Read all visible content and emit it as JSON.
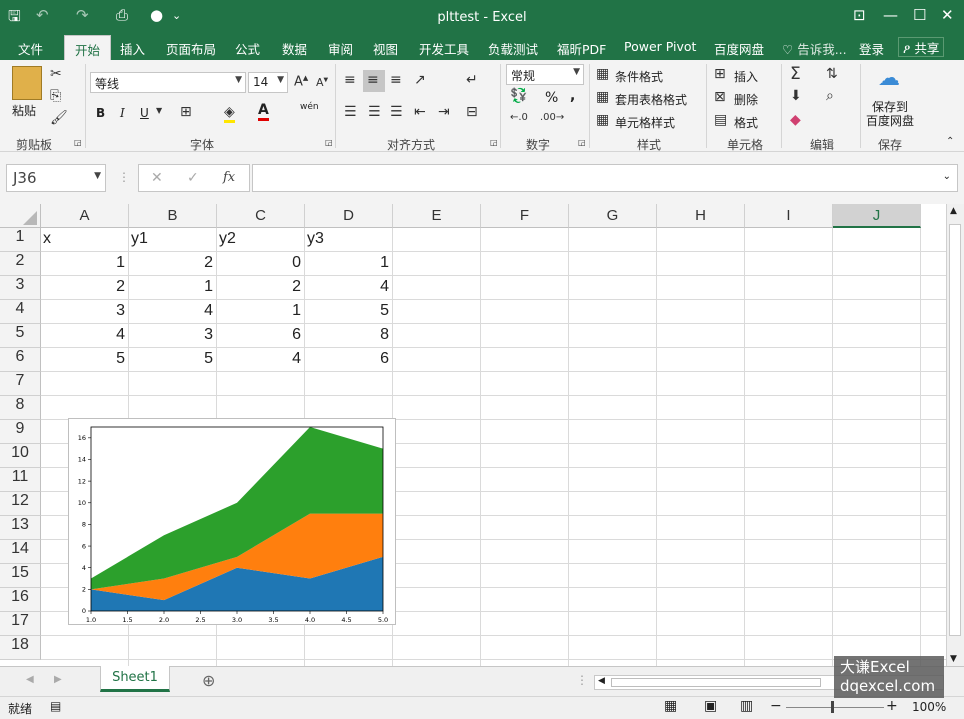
{
  "window": {
    "title": "plttest - Excel"
  },
  "tabs": [
    "文件",
    "开始",
    "插入",
    "页面布局",
    "公式",
    "数据",
    "审阅",
    "视图",
    "开发工具",
    "负载测试",
    "福昕PDF",
    "Power Pivot",
    "百度网盘"
  ],
  "active_tab": "开始",
  "tell_me": "告诉我...",
  "login": "登录",
  "share": "共享",
  "ribbon": {
    "clipboard": {
      "paste": "粘贴",
      "label": "剪贴板"
    },
    "font": {
      "name": "等线",
      "size": "14",
      "bold": "B",
      "italic": "I",
      "underline": "U",
      "phonetic": "wén",
      "label": "字体"
    },
    "alignment": {
      "label": "对齐方式"
    },
    "number": {
      "format": "常规",
      "percent": "%",
      "comma": ",",
      "label": "数字"
    },
    "styles": {
      "conditional": "条件格式",
      "table": "套用表格格式",
      "cell": "单元格样式",
      "label": "样式"
    },
    "cells": {
      "insert": "插入",
      "delete": "删除",
      "format": "格式",
      "label": "单元格"
    },
    "editing": {
      "label": "编辑"
    },
    "save": {
      "button": "保存到\n百度网盘",
      "label": "保存"
    }
  },
  "namebox": "J36",
  "fx": "fx",
  "columns": [
    "A",
    "B",
    "C",
    "D",
    "E",
    "F",
    "G",
    "H",
    "I",
    "J"
  ],
  "rows": [
    "1",
    "2",
    "3",
    "4",
    "5",
    "6",
    "7",
    "8",
    "9",
    "10",
    "11",
    "12",
    "13",
    "14",
    "15",
    "16",
    "17",
    "18"
  ],
  "headers": [
    "x",
    "y1",
    "y2",
    "y3"
  ],
  "table": [
    [
      1,
      2,
      0,
      1
    ],
    [
      2,
      1,
      2,
      4
    ],
    [
      3,
      4,
      1,
      5
    ],
    [
      4,
      3,
      6,
      8
    ],
    [
      5,
      5,
      4,
      6
    ]
  ],
  "sheet_tab": "Sheet1",
  "status": "就绪",
  "zoom": "100%",
  "watermark": {
    "line1": "大谦Excel",
    "line2": "dqexcel.com"
  },
  "chart_data": {
    "type": "area",
    "stacked": true,
    "x": [
      1,
      2,
      3,
      4,
      5
    ],
    "series": [
      {
        "values": [
          2,
          1,
          4,
          3,
          5
        ],
        "color": "#1f77b4"
      },
      {
        "values": [
          0,
          2,
          1,
          6,
          4
        ],
        "color": "#ff7f0e"
      },
      {
        "values": [
          1,
          4,
          5,
          8,
          6
        ],
        "color": "#2ca02c"
      }
    ],
    "xticks": [
      "1.0",
      "1.5",
      "2.0",
      "2.5",
      "3.0",
      "3.5",
      "4.0",
      "4.5",
      "5.0"
    ],
    "yticks": [
      "0",
      "2",
      "4",
      "6",
      "8",
      "10",
      "12",
      "14",
      "16"
    ],
    "xlim": [
      1,
      5
    ],
    "ylim": [
      0,
      17
    ],
    "grid": false
  }
}
